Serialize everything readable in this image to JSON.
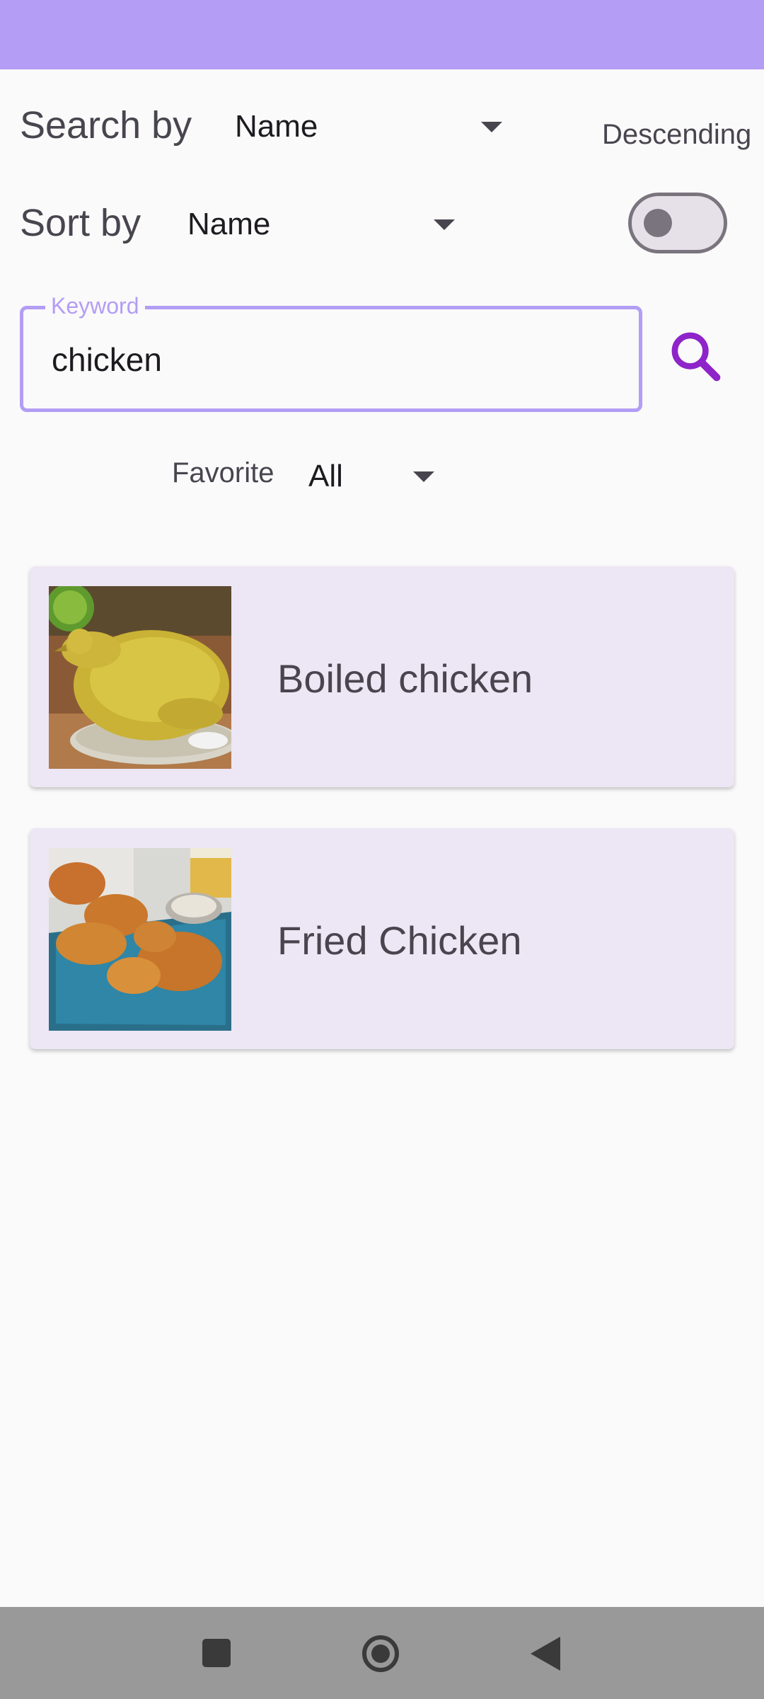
{
  "header": {
    "color": "#b39df5"
  },
  "search_by": {
    "label": "Search by",
    "selected": "Name"
  },
  "sort_by": {
    "label": "Sort by",
    "selected": "Name"
  },
  "order": {
    "label": "Descending",
    "toggle_on": false
  },
  "keyword": {
    "label": "Keyword",
    "value": "chicken"
  },
  "search_button": {
    "icon": "search-icon",
    "color": "#8e24c9"
  },
  "favorite": {
    "label": "Favorite",
    "selected": "All"
  },
  "results": [
    {
      "title": "Boiled chicken",
      "image": "boiled-chicken-photo"
    },
    {
      "title": "Fried Chicken",
      "image": "fried-chicken-photo"
    }
  ],
  "nav": {
    "buttons": [
      "recents-icon",
      "home-icon",
      "back-icon"
    ]
  }
}
